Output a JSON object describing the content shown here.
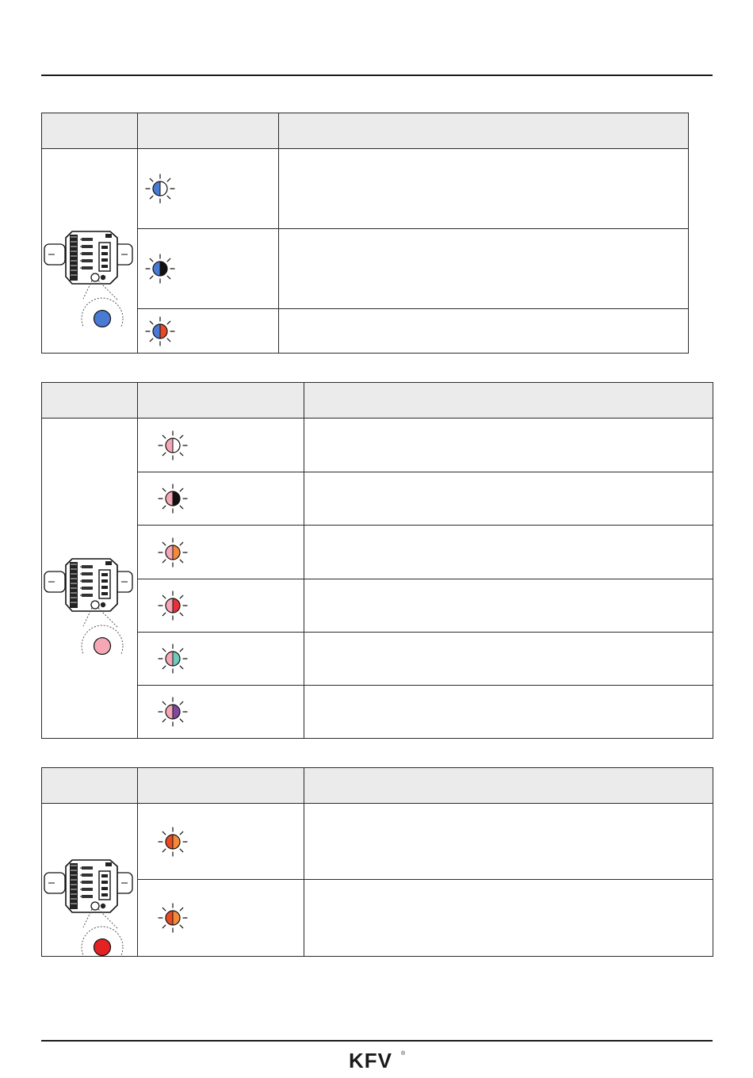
{
  "footer": {
    "logo_text": "KFV",
    "logo_mark": "®"
  },
  "colors": {
    "blue": "#4a7bd4",
    "black": "#111111",
    "orange_red": "#e84a24",
    "pink": "#f5a7b6",
    "light_pink": "#f8c9d3",
    "orange": "#f28a3c",
    "red": "#e8303a",
    "teal": "#6ccbbd",
    "purple": "#7e4aa0",
    "bright_red": "#e52222"
  },
  "tables": [
    {
      "device_dot_color": "#4a7bd4",
      "rows": [
        {
          "left": "#4a7bd4",
          "right": "#ffffff",
          "desc": ""
        },
        {
          "left": "#4a7bd4",
          "right": "#111111",
          "desc": ""
        },
        {
          "left": "#4a7bd4",
          "right": "#e84a24",
          "desc": ""
        }
      ]
    },
    {
      "device_dot_color": "#f5a7b6",
      "rows": [
        {
          "left": "#f5a7b6",
          "right": "#ffffff",
          "desc": ""
        },
        {
          "left": "#f5a7b6",
          "right": "#111111",
          "desc": ""
        },
        {
          "left": "#f5a7b6",
          "right": "#f28a3c",
          "desc": ""
        },
        {
          "left": "#f5a7b6",
          "right": "#e8303a",
          "desc": ""
        },
        {
          "left": "#f5a7b6",
          "right": "#6ccbbd",
          "desc": ""
        },
        {
          "left": "#f5a7b6",
          "right": "#7e4aa0",
          "desc": ""
        }
      ]
    },
    {
      "device_dot_color": "#e52222",
      "rows": [
        {
          "left": "#e84a24",
          "right": "#f28a3c",
          "desc": ""
        },
        {
          "left": "#e84a24",
          "right": "#f28a3c",
          "desc": ""
        }
      ]
    }
  ]
}
